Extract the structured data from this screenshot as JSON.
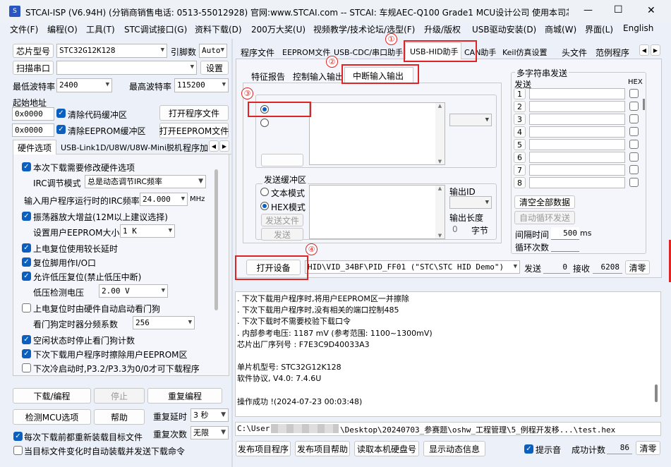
{
  "window": {
    "title": "STCAI-ISP (V6.94H) (分销商销售电话: 0513-55012928) 官网:www.STCAI.com  -- STCAI: 车规AEC-Q100 Grade1 MCU设计公司 使用本司芯片或采...",
    "min": "—",
    "max": "☐",
    "close": "✕"
  },
  "menu": [
    "文件(F)",
    "编程(O)",
    "工具(T)",
    "STC调试接口(G)",
    "资料下载(D)",
    "200万大奖(U)",
    "视频教学/技术论坛/选型(F)",
    "升级/版权",
    "USB驱动安装(D)",
    "商城(W)",
    "界面(L)",
    "English"
  ],
  "left": {
    "chip_btn": "芯片型号",
    "chip": "STC32G12K128",
    "pins_label": "引脚数",
    "pins": "Auto",
    "scan_btn": "扫描串口",
    "port": "",
    "settings_btn": "设置",
    "min_baud_label": "最低波特率",
    "min_baud": "2400",
    "max_baud_label": "最高波特率",
    "max_baud": "115200",
    "start_label": "起始地址",
    "addr1": "0x0000",
    "clear_code": "清除代码缓冲区",
    "open_prog": "打开程序文件",
    "addr2": "0x0000",
    "clear_eeprom": "清除EEPROM缓冲区",
    "open_eeprom": "打开EEPROM文件",
    "tabs": [
      "硬件选项",
      "USB-Link1D/U8W/U8W-Mini脱机",
      "程序加"
    ],
    "opts": {
      "o1": "本次下载需要修改硬件选项",
      "irc_label": "IRC调节模式",
      "irc": "总是动态调节IRC频率",
      "freq_label": "输入用户程序运行时的IRC频率",
      "freq": "24.000",
      "mhz": "MHz",
      "o2": "振荡器放大增益(12M以上建议选择)",
      "eeprom_label": "设置用户EEPROM大小",
      "eeprom": "1   K",
      "o3": "上电复位使用较长延时",
      "o4": "复位脚用作I/O口",
      "o5": "允许低压复位(禁止低压中断)",
      "lv_label": "低压检测电压",
      "lv": "2.00 V",
      "o6": "上电复位时由硬件自动启动看门狗",
      "wdt_label": "看门狗定时器分频系数",
      "wdt": "256",
      "o7": "空闲状态时停止看门狗计数",
      "o8": "下次下载用户程序时擦除用户EEPROM区",
      "o9": "下次冷启动时,P3.2/P3.3为0/0才可下载程序"
    },
    "download_btn": "下载/编程",
    "stop_btn": "停止",
    "redownload_btn": "重复编程",
    "check_btn": "检测MCU选项",
    "help_btn": "帮助",
    "delay_label": "重复延时",
    "delay": "3 秒",
    "times_label": "重复次数",
    "times": "无限",
    "reload": "每次下载前都重新装载目标文件",
    "autoload": "当目标文件变化时自动装载并发送下载命令"
  },
  "right": {
    "tabs": [
      "程序文件",
      "EEPROM文件",
      "USB-CDC/串口助手",
      "USB-HID助手",
      "CAN助手",
      "Keil仿真设置",
      "头文件",
      "范例程序"
    ],
    "subtabs": [
      "特征报告",
      "控制输入输出",
      "中断输入输出"
    ],
    "recv": "6208",
    "send": {
      "title": "发送缓冲区",
      "text": "文本模式",
      "hex": "HEX模式",
      "file": "发送文件",
      "send": "发送",
      "id_label": "输出ID",
      "len_label": "输出长度",
      "len": "0",
      "unit": "字节"
    },
    "multi": {
      "title": "多字符串发送",
      "send_label": "发送",
      "hex_label": "HEX",
      "rows": [
        "1",
        "2",
        "3",
        "4",
        "5",
        "6",
        "7",
        "8"
      ],
      "clear_all": "清空全部数据",
      "auto_loop": "自动循环发送",
      "interval_label": "间隔时间",
      "interval": "500",
      "ms": "ms",
      "loops_label": "循环次数"
    },
    "open_device": "打开设备",
    "device": "HID\\VID_34BF\\PID_FF01 (\"STC\\STC HID Demo\")",
    "sent_label": "发送",
    "sent": "0",
    "recv_label": "接收",
    "clear": "清零",
    "annot": [
      "①",
      "②",
      "③",
      "④"
    ]
  },
  "log": [
    " . 下次下载用户程序时,将用户EEPROM区一并擦除",
    " . 下次下载用户程序时,没有相关的端口控制485",
    " . 下次下载时不需要校验下载口令",
    " . 内部参考电压: 1187 mV (参考范围: 1100~1300mV)",
    "芯片出厂序列号 : F7E3C9D40033A3",
    "",
    "  单片机型号: STC32G12K128",
    "  软件协议, V4.0: 7.4.6U",
    "",
    "操作成功 !(2024-07-23 00:03:48)"
  ],
  "path": {
    "prefix": "C:\\User",
    "suffix": "\\Desktop\\20240703_参赛题\\oshw_工程管理\\5_例程开发移...\\test.hex"
  },
  "bottom": {
    "publish": "发布项目程序",
    "publish_help": "发布项目帮助",
    "read_disk": "读取本机硬盘号",
    "show_info": "显示动态信息",
    "beep": "提示音",
    "success_label": "成功计数",
    "success": "86",
    "clear": "清零"
  }
}
